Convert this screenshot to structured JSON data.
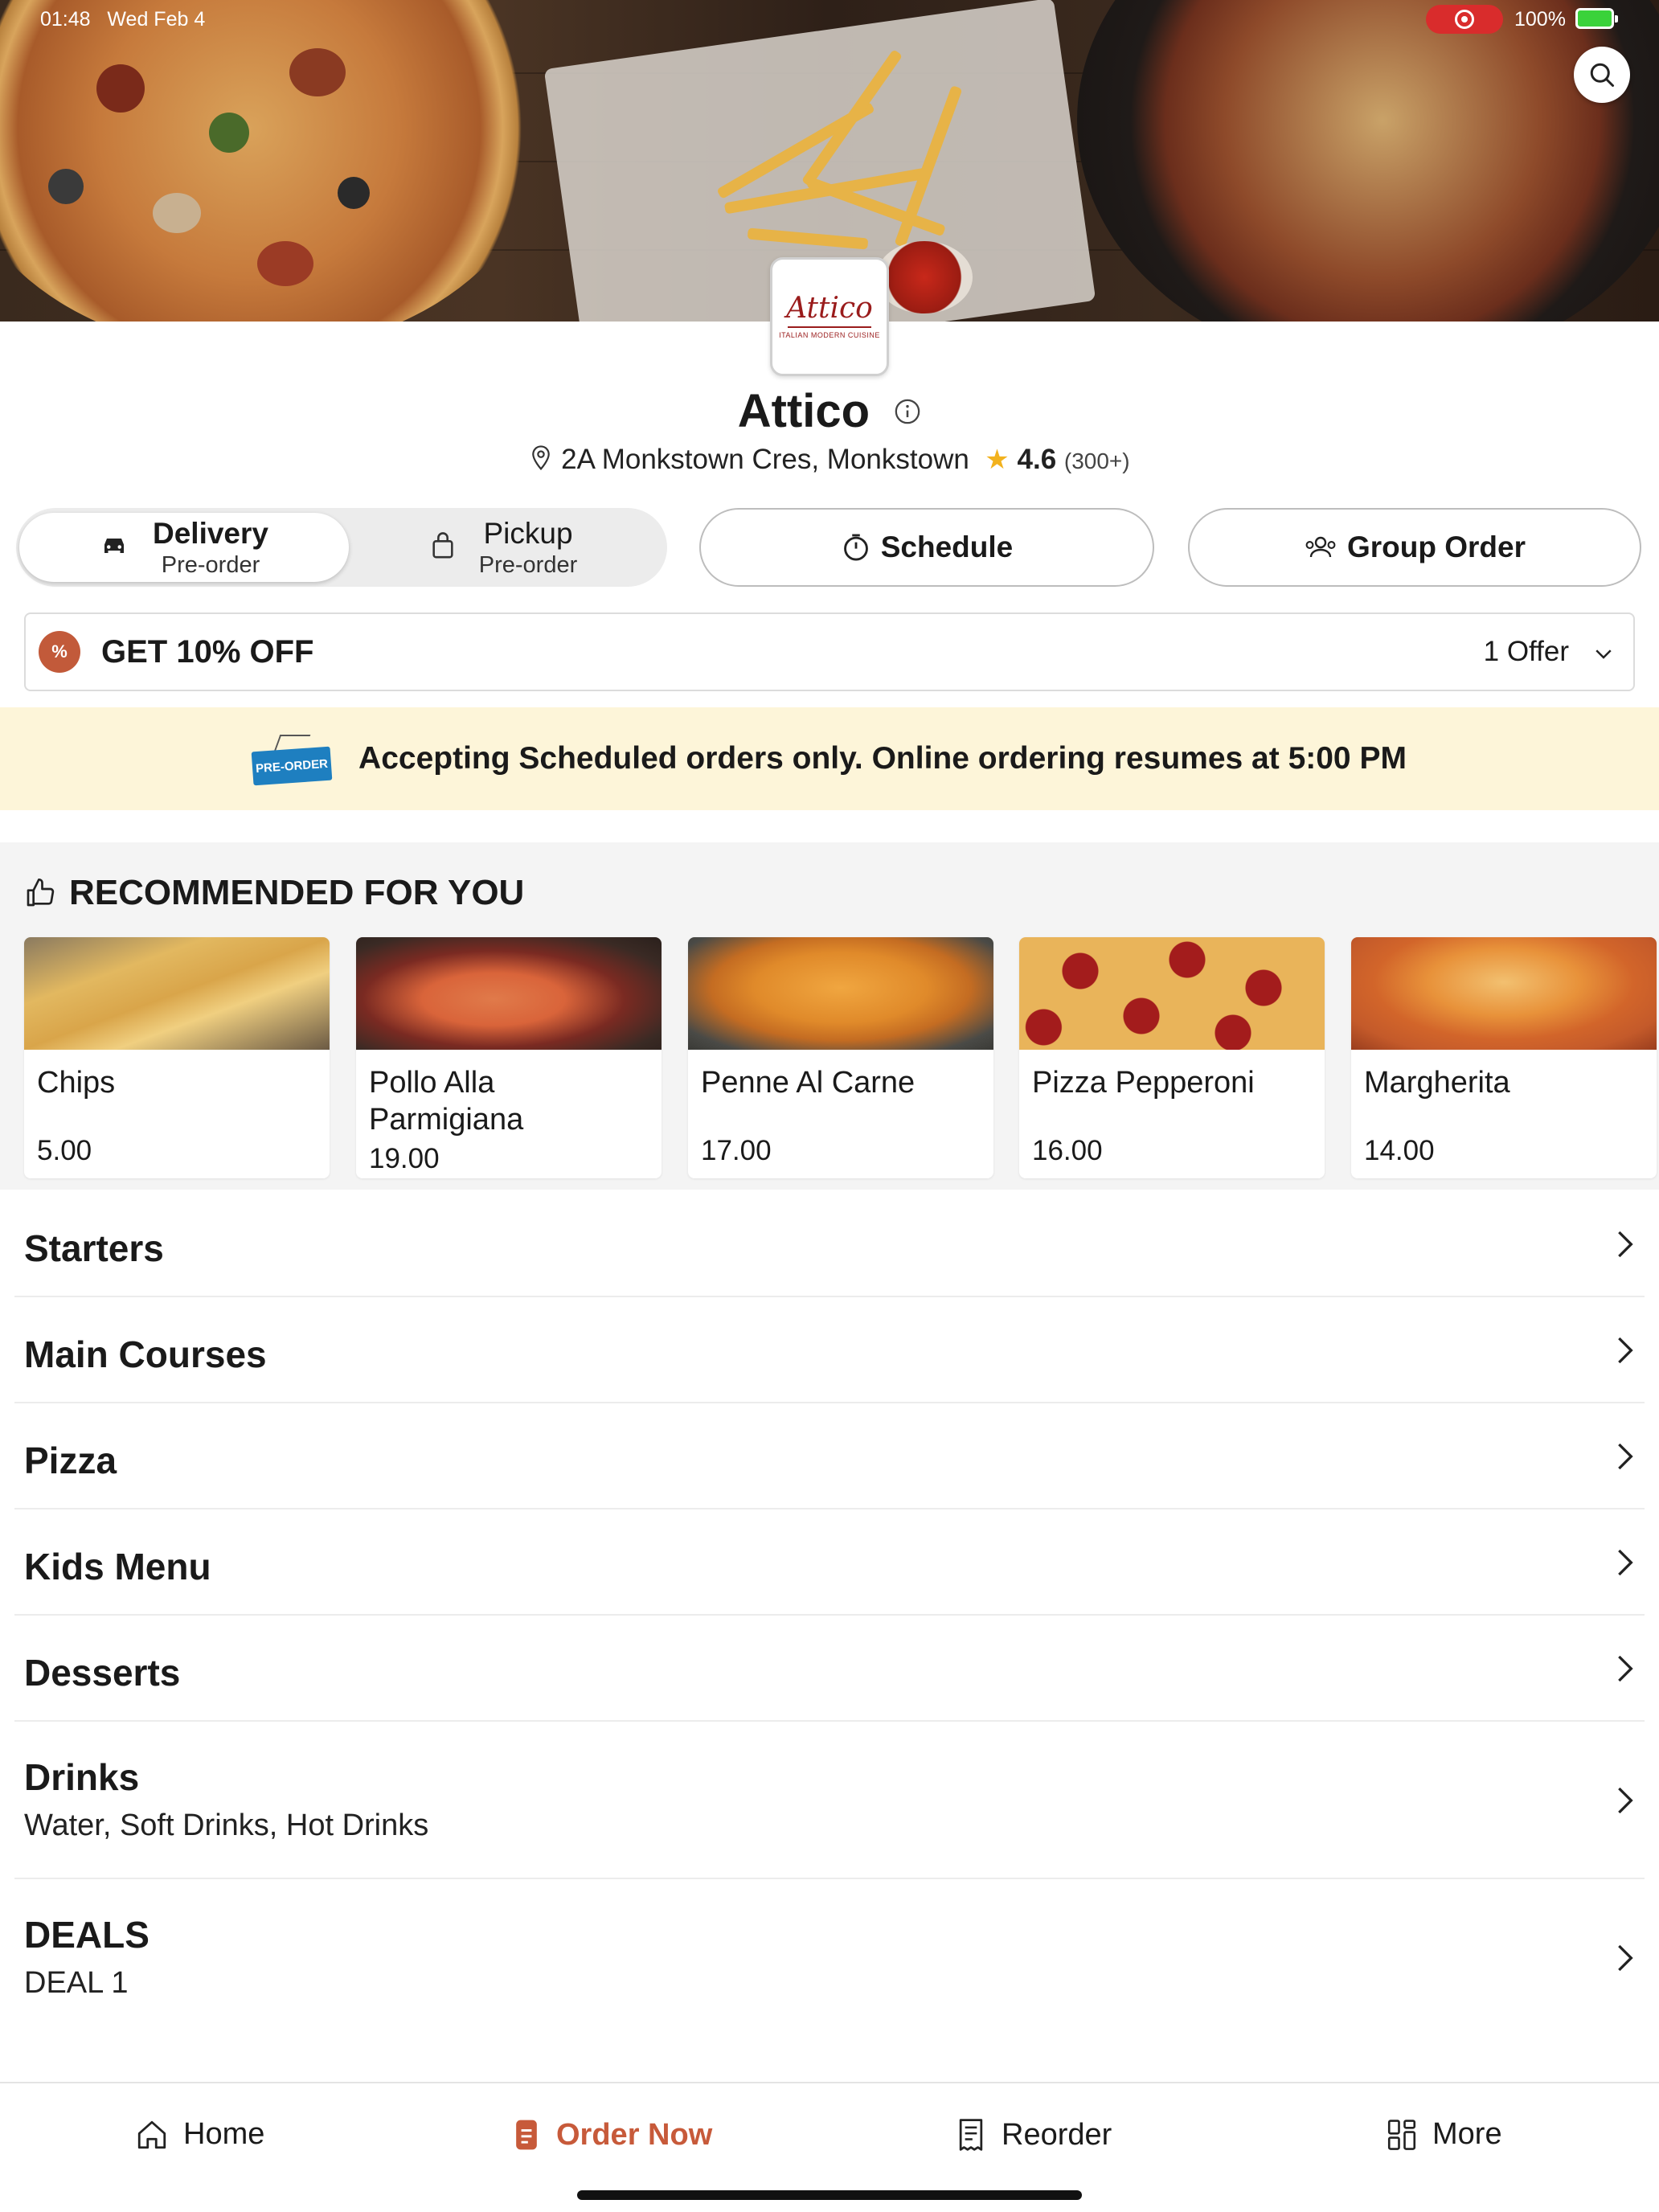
{
  "status_bar": {
    "time": "01:48",
    "date": "Wed Feb 4",
    "battery": "100%"
  },
  "restaurant": {
    "logo_text": "Attico",
    "logo_subtext": "ITALIAN MODERN CUISINE",
    "name": "Attico",
    "address": "2A Monkstown Cres, Monkstown",
    "rating": "4.6",
    "rating_count": "(300+)"
  },
  "order_mode": {
    "delivery": {
      "label": "Delivery",
      "sub": "Pre-order",
      "selected": true
    },
    "pickup": {
      "label": "Pickup",
      "sub": "Pre-order",
      "selected": false
    }
  },
  "actions": {
    "schedule": "Schedule",
    "group_order": "Group Order"
  },
  "offer": {
    "title": "GET 10% OFF",
    "count": "1 Offer",
    "badge": "%"
  },
  "banner": {
    "tag": "PRE-ORDER",
    "text": "Accepting Scheduled orders only. Online ordering resumes at 5:00 PM"
  },
  "recommended": {
    "header": "RECOMMENDED FOR YOU",
    "items": [
      {
        "name": "Chips",
        "price": "5.00"
      },
      {
        "name": "Pollo Alla Parmigiana",
        "price": "19.00"
      },
      {
        "name": "Penne Al Carne",
        "price": "17.00"
      },
      {
        "name": "Pizza Pepperoni",
        "price": "16.00"
      },
      {
        "name": "Margherita",
        "price": "14.00"
      }
    ]
  },
  "menu": [
    {
      "title": "Starters",
      "sub": ""
    },
    {
      "title": "Main Courses",
      "sub": ""
    },
    {
      "title": "Pizza",
      "sub": ""
    },
    {
      "title": "Kids Menu",
      "sub": ""
    },
    {
      "title": "Desserts",
      "sub": ""
    },
    {
      "title": "Drinks",
      "sub": "Water, Soft Drinks, Hot Drinks"
    },
    {
      "title": "DEALS",
      "sub": "DEAL 1"
    }
  ],
  "bottom_nav": {
    "home": "Home",
    "order_now": "Order Now",
    "reorder": "Reorder",
    "more": "More"
  },
  "colors": {
    "accent": "#c75a3a",
    "banner_bg": "#fdf5d9",
    "star": "#f2b21e",
    "preorder_tag": "#1e7fc0"
  }
}
